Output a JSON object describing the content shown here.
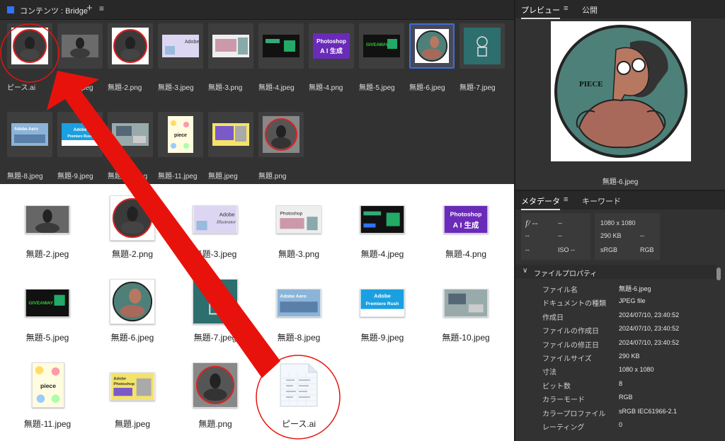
{
  "content": {
    "title": "コンテンツ : Bridge",
    "plus": "+",
    "menu": "≡",
    "row1": [
      "ピース.ai",
      "無題-2.jpeg",
      "無題-2.png",
      "無題-3.jpeg",
      "無題-3.png",
      "無題-4.jpeg",
      "無題-4.png",
      "無題-5.jpeg",
      "無題-6.jpeg",
      "無題-7.jpeg"
    ],
    "row2": [
      "無題-8.jpeg",
      "無題-9.jpeg",
      "無題-10.jpeg",
      "無題-11.jpeg",
      "無題.jpeg",
      "無題.png"
    ]
  },
  "thumb_text": {
    "adobe": "Adobe",
    "illustrator": "Illustrator",
    "photoshop": "Photoshop",
    "ai_gen": "A I 生成",
    "giveaway": "GIVEAWAY",
    "premiere_rush": "Premiere Rush",
    "adobe_aero": "Adobe Aero",
    "piece_logo": "piece",
    "piece_text": "PIECE"
  },
  "preview": {
    "tab_active": "プレビュー",
    "tab_menu": "≡",
    "tab_other": "公開",
    "filename": "無題-6.jpeg"
  },
  "metadata": {
    "tab_active": "メタデータ",
    "tab_menu": "≡",
    "tab_other": "キーワード",
    "camera": {
      "fstop": "f/ --",
      "shutter": "--",
      "c1": "--",
      "c2": "--",
      "c3": "--",
      "iso": "ISO --"
    },
    "image": {
      "dims": "1080 x 1080",
      "size": "290 KB",
      "dash": "--",
      "profile": "sRGB",
      "mode": "RGB"
    },
    "section_title": "ファイルプロパティ",
    "properties": [
      {
        "key": "ファイル名",
        "value": "無題-6.jpeg"
      },
      {
        "key": "ドキュメントの種類",
        "value": "JPEG file"
      },
      {
        "key": "作成日",
        "value": "2024/07/10, 23:40:52"
      },
      {
        "key": "ファイルの作成日",
        "value": "2024/07/10, 23:40:52"
      },
      {
        "key": "ファイルの修正日",
        "value": "2024/07/10, 23:40:52"
      },
      {
        "key": "ファイルサイズ",
        "value": "290 KB"
      },
      {
        "key": "寸法",
        "value": "1080 x 1080"
      },
      {
        "key": "ビット数",
        "value": "8"
      },
      {
        "key": "カラーモード",
        "value": "RGB"
      },
      {
        "key": "カラープロファイル",
        "value": "sRGB IEC61966-2.1"
      },
      {
        "key": "レーティング",
        "value": "0"
      }
    ]
  },
  "finder": {
    "files": [
      "無題-2.jpeg",
      "無題-2.png",
      "無題-3.jpeg",
      "無題-3.png",
      "無題-4.jpeg",
      "無題-4.png",
      "無題-5.jpeg",
      "無題-6.jpeg",
      "無題-7.jpeg",
      "無題-8.jpeg",
      "無題-9.jpeg",
      "無題-10.jpeg",
      "無題-11.jpeg",
      "無題.jpeg",
      "無題.png",
      "ピース.ai"
    ]
  },
  "colors": {
    "accent_blue": "#2f74ff",
    "selection_border": "#3d6fd1",
    "annotation_red": "#e8120c",
    "panel_bg": "#323232",
    "horse_bg": "#4d8078",
    "teal_bg": "#2d6e6e"
  }
}
